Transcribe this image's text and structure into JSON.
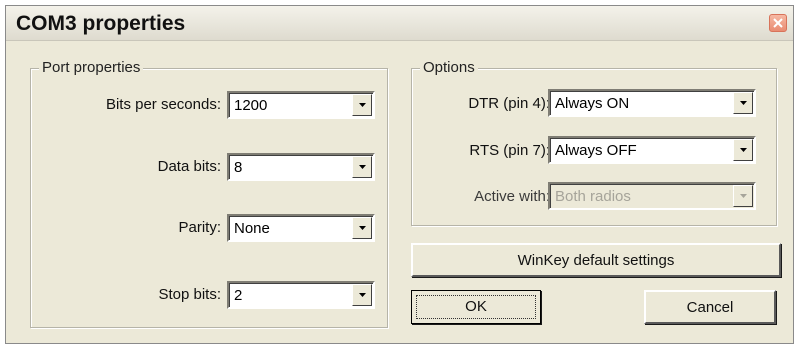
{
  "window": {
    "title": "COM3 properties",
    "close_icon": "close-icon"
  },
  "port_properties": {
    "legend": "Port properties",
    "bits_per_second": {
      "label": "Bits per seconds:",
      "value": "1200"
    },
    "data_bits": {
      "label": "Data bits:",
      "value": "8"
    },
    "parity": {
      "label": "Parity:",
      "value": "None"
    },
    "stop_bits": {
      "label": "Stop bits:",
      "value": "2"
    }
  },
  "options": {
    "legend": "Options",
    "dtr": {
      "label": "DTR (pin 4):",
      "value": "Always ON"
    },
    "rts": {
      "label": "RTS (pin 7):",
      "value": "Always OFF"
    },
    "active_with": {
      "label": "Active with:",
      "value": "Both radios",
      "disabled": true
    }
  },
  "buttons": {
    "winkey_default": "WinKey default settings",
    "ok": "OK",
    "cancel": "Cancel"
  },
  "colors": {
    "dialog_background": "#ece9d8",
    "close_button": "#e98c72"
  }
}
